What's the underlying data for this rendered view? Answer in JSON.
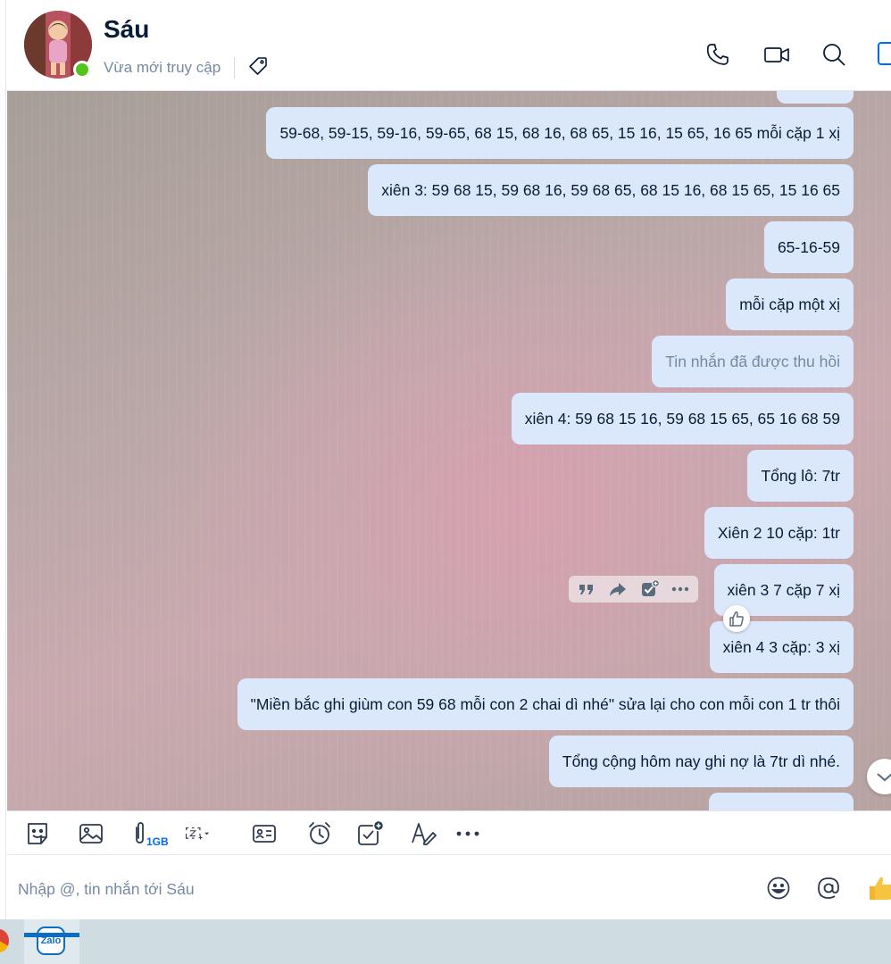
{
  "header": {
    "contact_name": "Sáu",
    "status": "Vừa mới truy cập"
  },
  "messages": [
    {
      "text": ""
    },
    {
      "text": "59-68, 59-15, 59-16, 59-65, 68 15, 68 16, 68 65, 15 16, 15 65, 16 65 mỗi cặp 1 xị"
    },
    {
      "text": "xiên 3: 59 68 15, 59 68 16, 59 68 65, 68 15 16, 68 15 65, 15 16 65"
    },
    {
      "text": "65-16-59"
    },
    {
      "text": "mỗi cặp một xị"
    },
    {
      "text": "Tin nhắn đã được thu hồi"
    },
    {
      "text": "xiên 4: 59 68 15 16, 59 68 15 65, 65 16 68 59"
    },
    {
      "text": "Tổng lô: 7tr"
    },
    {
      "text": "Xiên 2 10 cặp: 1tr"
    },
    {
      "text": "xiên 3 7 cặp 7 xị"
    },
    {
      "text": "xiên 4 3 cặp: 3 xị"
    },
    {
      "text": "\"Miền bắc ghi giùm con 59 68 mỗi con 2 chai dì nhé\" sửa lại cho con mỗi con 1 tr thôi"
    },
    {
      "text": "Tổng cộng hôm nay ghi nợ là 7tr dì nhé."
    },
    {
      "text": ""
    }
  ],
  "toolbar": {
    "file_size_limit": "1GB"
  },
  "composer": {
    "placeholder": "Nhập @, tin nhắn tới Sáu"
  },
  "taskbar": {
    "app_label": "Zalo"
  },
  "colors": {
    "bubble": "#dbe8fb",
    "accent": "#0068ff",
    "online": "#52c41a"
  }
}
